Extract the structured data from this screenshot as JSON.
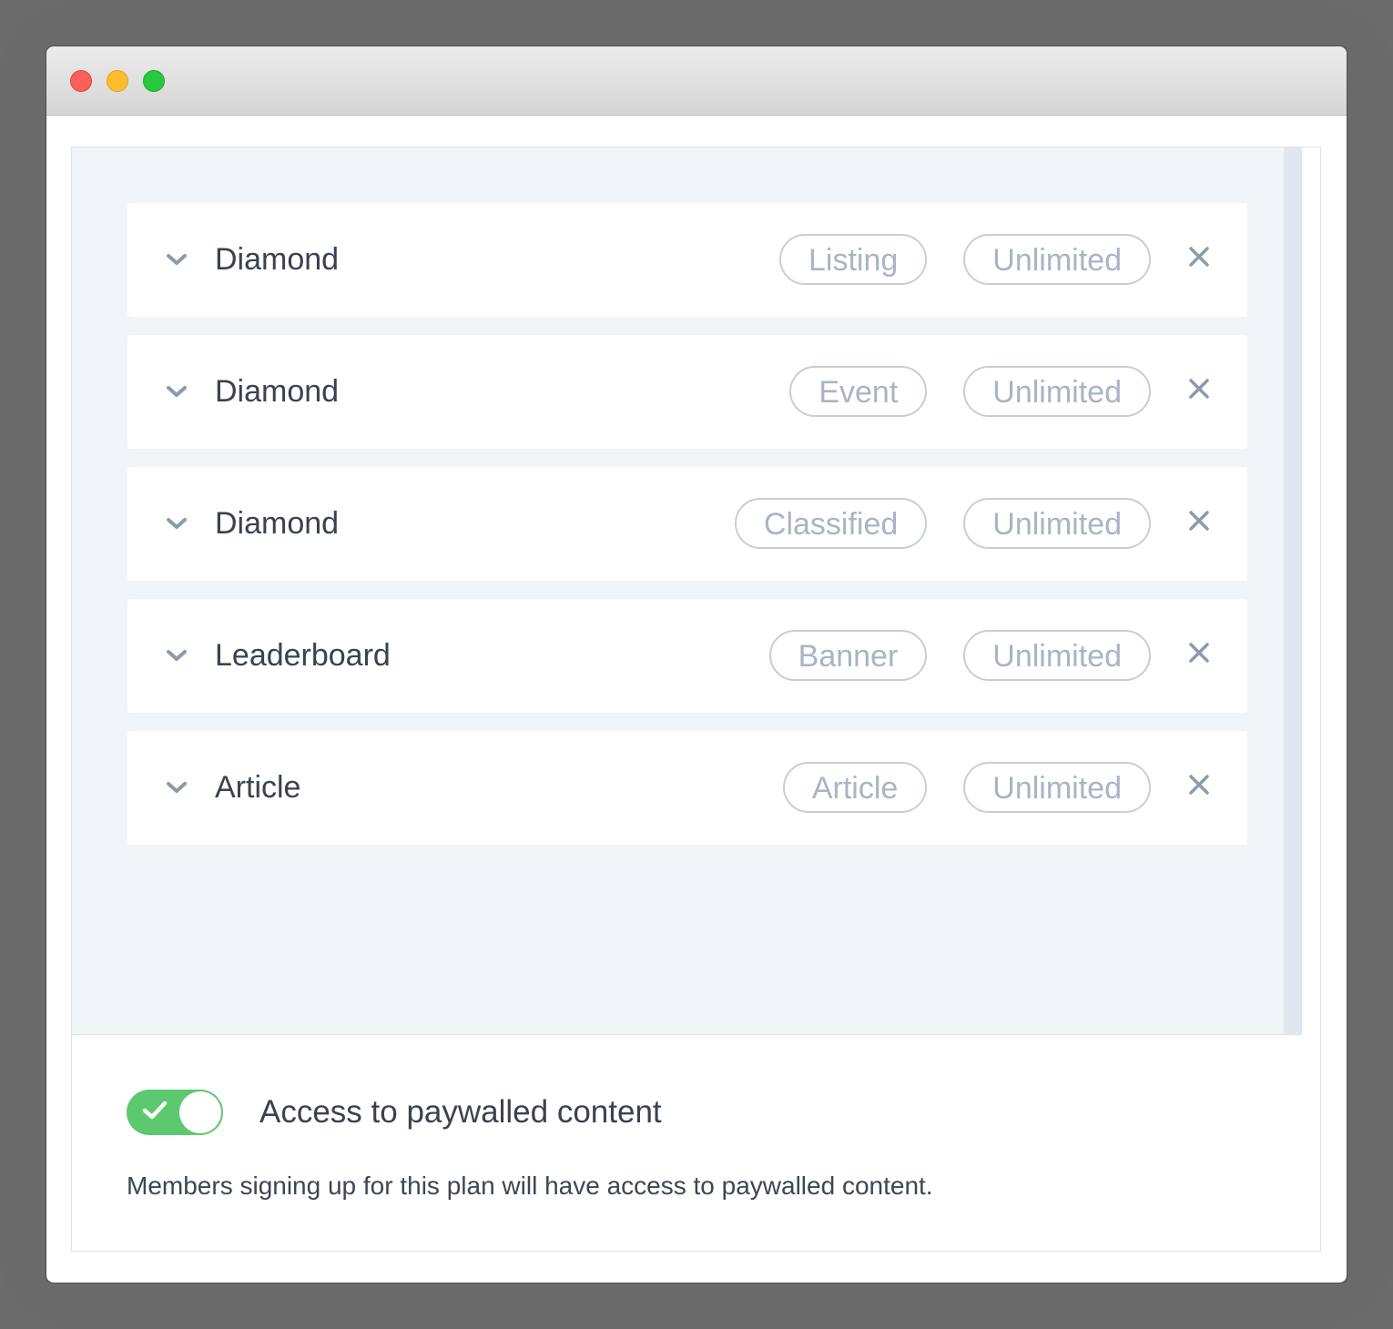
{
  "window": {
    "controls": [
      "close",
      "minimize",
      "zoom"
    ]
  },
  "plan_items": [
    {
      "title": "Diamond",
      "type": "Listing",
      "quantity": "Unlimited"
    },
    {
      "title": "Diamond",
      "type": "Event",
      "quantity": "Unlimited"
    },
    {
      "title": "Diamond",
      "type": "Classified",
      "quantity": "Unlimited"
    },
    {
      "title": "Leaderboard",
      "type": "Banner",
      "quantity": "Unlimited"
    },
    {
      "title": "Article",
      "type": "Article",
      "quantity": "Unlimited"
    }
  ],
  "paywall": {
    "toggle_on": true,
    "label": "Access to paywalled content",
    "description": "Members signing up for this plan will have access to paywalled content."
  },
  "colors": {
    "toggle_on": "#5cc86f",
    "pill_border": "#c7ced8",
    "pill_text": "#a9b4c4",
    "list_background": "#f2f5f8",
    "icon": "#8e9aab"
  },
  "icons": {
    "row_expand": "chevron-down-icon",
    "row_remove": "close-icon",
    "toggle_check": "check-icon"
  }
}
